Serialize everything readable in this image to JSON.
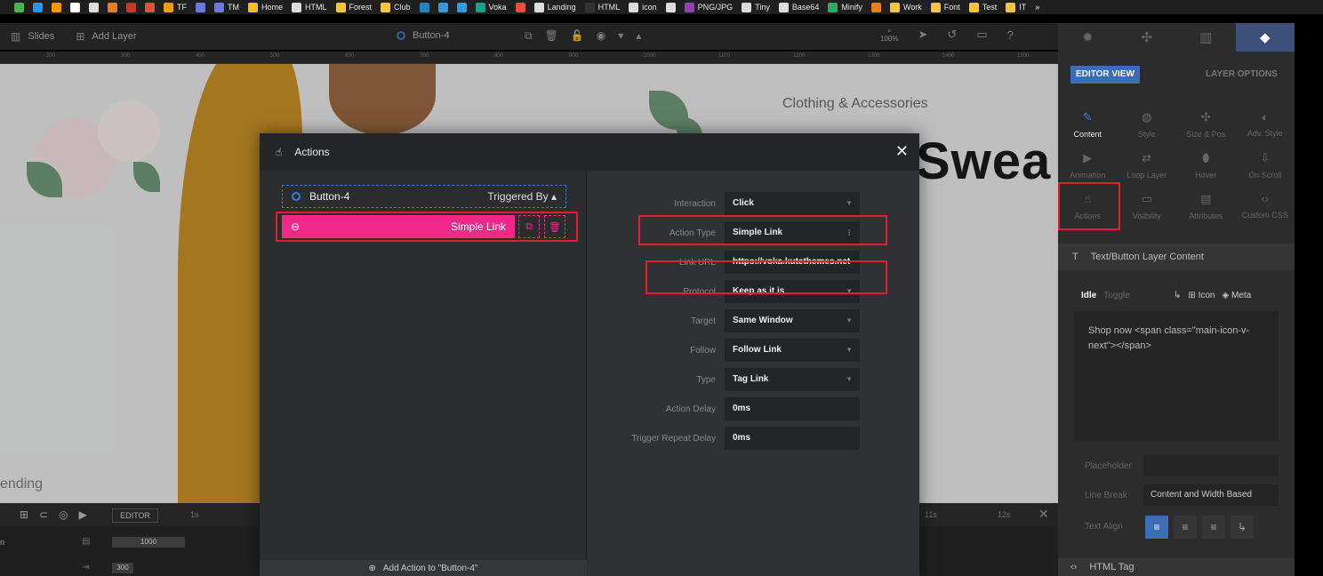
{
  "bookmarks": [
    {
      "label": "",
      "color": "#4caf50"
    },
    {
      "label": "",
      "color": "#2196f3"
    },
    {
      "label": "",
      "color": "#ff9800"
    },
    {
      "label": "",
      "color": "#ffffff"
    },
    {
      "label": "",
      "color": "#dddddd"
    },
    {
      "label": "",
      "color": "#e67e22"
    },
    {
      "label": "",
      "color": "#c0392b"
    },
    {
      "label": "",
      "color": "#e74c3c"
    },
    {
      "label": "TF",
      "color": "#f39c12"
    },
    {
      "label": "",
      "color": "#6c7ae0"
    },
    {
      "label": "TM",
      "color": "#6c7ae0"
    },
    {
      "label": "Home",
      "color": "#f1c40f"
    },
    {
      "label": "HTML",
      "color": "#dddddd"
    },
    {
      "label": "Forest",
      "color": "#f4c542"
    },
    {
      "label": "Club",
      "color": "#f4c542"
    },
    {
      "label": "",
      "color": "#2980b9"
    },
    {
      "label": "",
      "color": "#3498db"
    },
    {
      "label": "",
      "color": "#3498db"
    },
    {
      "label": "Voka",
      "color": "#16a085"
    },
    {
      "label": "",
      "color": "#e74c3c"
    },
    {
      "label": "Landing",
      "color": "#dddddd"
    },
    {
      "label": "HTML",
      "color": "#333333"
    },
    {
      "label": "icon",
      "color": "#dddddd"
    },
    {
      "label": "",
      "color": "#dddddd"
    },
    {
      "label": "PNG/JPG",
      "color": "#8e44ad"
    },
    {
      "label": "Tiny",
      "color": "#dddddd"
    },
    {
      "label": "Base64",
      "color": "#dddddd"
    },
    {
      "label": "Minify",
      "color": "#27ae60"
    },
    {
      "label": "",
      "color": "#e67e22"
    },
    {
      "label": "Work",
      "color": "#f4c542"
    },
    {
      "label": "Font",
      "color": "#f4c542"
    },
    {
      "label": "Test",
      "color": "#f4c542"
    },
    {
      "label": "IT",
      "color": "#f4c542"
    },
    {
      "label": "»",
      "color": ""
    }
  ],
  "toolbar": {
    "slides": "Slides",
    "add_layer": "Add Layer",
    "layer_name": "Button-4",
    "zoom_icon": "magnifier-icon",
    "zoom": "100%"
  },
  "ruler": [
    "200",
    "300",
    "400",
    "500",
    "600",
    "700",
    "800",
    "900",
    "1000",
    "1100",
    "1200",
    "1300",
    "1400",
    "1500"
  ],
  "canvas": {
    "subtitle": "Clothing & Accessories",
    "headline": "Swea",
    "trending": "ending"
  },
  "timeline": {
    "editor": "EDITOR",
    "t1": "1s",
    "t11": "11s",
    "t12": "12s",
    "row1_left": "n",
    "row1_value": "1000",
    "row2_value": "300"
  },
  "rpanel": {
    "editor_view": "EDITOR VIEW",
    "layer_options": "LAYER OPTIONS",
    "row1": [
      "Content",
      "Style",
      "Size & Pos",
      "Adv. Style"
    ],
    "row2": [
      "Animation",
      "Loop Layer",
      "Hover",
      "On Scroll"
    ],
    "row3": [
      "Actions",
      "Visibility",
      "Attributes",
      "Custom CSS"
    ],
    "section_title": "Text/Button Layer Content",
    "idle": "Idle",
    "toggle": "Toggle",
    "icon": "Icon",
    "meta": "Meta",
    "content_text": "Shop now <span class=\"main-icon-v-next\"></span>",
    "placeholder": "Placeholder",
    "line_break_label": "Line Break",
    "line_break_value": "Content and Width Based",
    "text_align": "Text Align",
    "html_tag": "HTML Tag"
  },
  "modal": {
    "title": "Actions",
    "trigger_layer": "Button-4",
    "triggered_by": "Triggered By",
    "action_label": "Simple Link",
    "add_action": "Add Action to \"Button-4\"",
    "fields": [
      {
        "label": "Interaction",
        "value": "Click",
        "dropdown": true
      },
      {
        "label": "Action Type",
        "value": "Simple Link",
        "dropdown": false
      },
      {
        "label": "Link URL",
        "value": "https://voka.kutethemes.net",
        "dropdown": false
      },
      {
        "label": "Protocol",
        "value": "Keep as it is",
        "dropdown": true
      },
      {
        "label": "Target",
        "value": "Same Window",
        "dropdown": true
      },
      {
        "label": "Follow",
        "value": "Follow Link",
        "dropdown": true
      },
      {
        "label": "Type",
        "value": "Tag Link",
        "dropdown": true
      },
      {
        "label": "Action Delay",
        "value": "0ms",
        "dropdown": false
      },
      {
        "label": "Trigger Repeat Delay",
        "value": "0ms",
        "dropdown": false
      }
    ]
  },
  "colors": {
    "accent": "#f0288a",
    "primary": "#3c6bb8",
    "highlight": "#e0202c"
  }
}
